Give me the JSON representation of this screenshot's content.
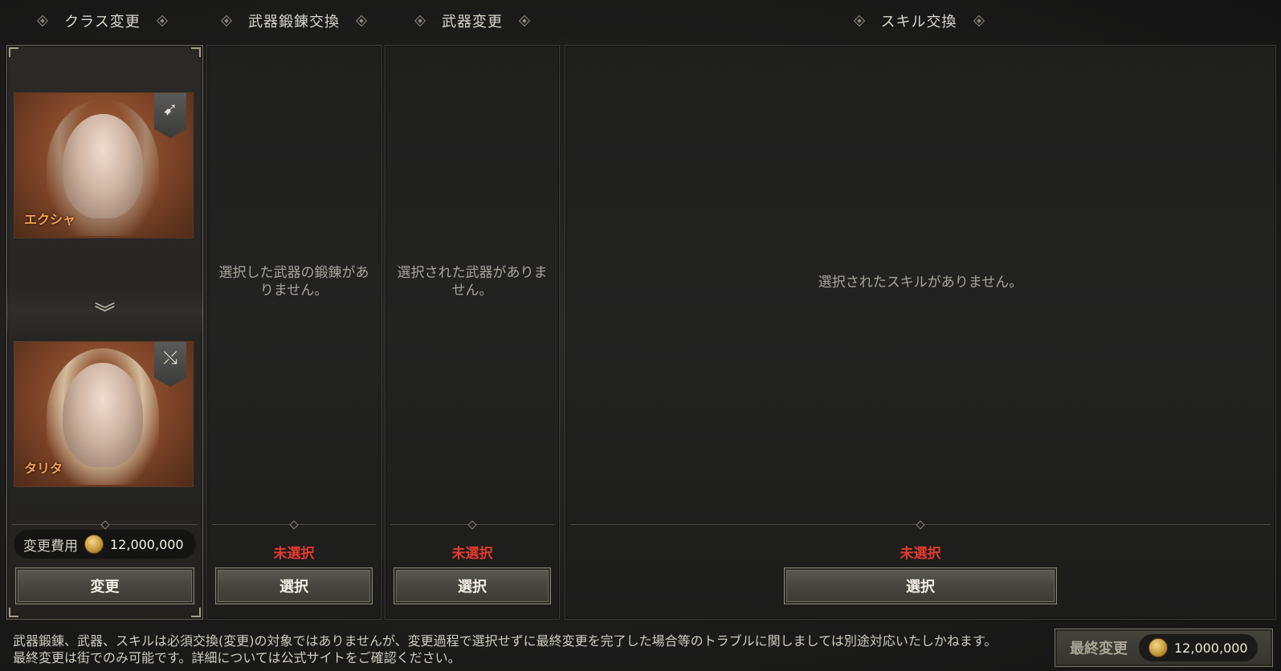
{
  "headers": {
    "class_change": "クラス変更",
    "weapon_refine": "武器鍛錬交換",
    "weapon_change": "武器変更",
    "skill_exchange": "スキル交換"
  },
  "class_panel": {
    "from_name": "エクシャ",
    "to_name": "タリタ",
    "from_class_icon": "bow-icon",
    "to_class_icon": "crossbow-icon",
    "cost_label": "変更費用",
    "cost_value": "12,000,000",
    "change_button": "変更"
  },
  "refine_panel": {
    "empty_message": "選択した武器の鍛錬がありません。",
    "status": "未選択",
    "select_button": "選択"
  },
  "weapon_panel": {
    "empty_message": "選択された武器がありません。",
    "status": "未選択",
    "select_button": "選択"
  },
  "skill_panel": {
    "empty_message": "選択されたスキルがありません。",
    "status": "未選択",
    "select_button": "選択"
  },
  "footer": {
    "note_line1": "武器鍛錬、武器、スキルは必須交換(変更)の対象ではありませんが、変更過程で選択せずに最終変更を完了した場合等のトラブルに関しましては別途対応いたしかねます。",
    "note_line2": "最終変更は街でのみ可能です。詳細については公式サイトをご確認ください。",
    "final_button": "最終変更",
    "final_cost": "12,000,000"
  },
  "colors": {
    "status_red": "#e23a2e",
    "name_orange": "#f0a050",
    "portrait_bg": "#7c4327"
  }
}
